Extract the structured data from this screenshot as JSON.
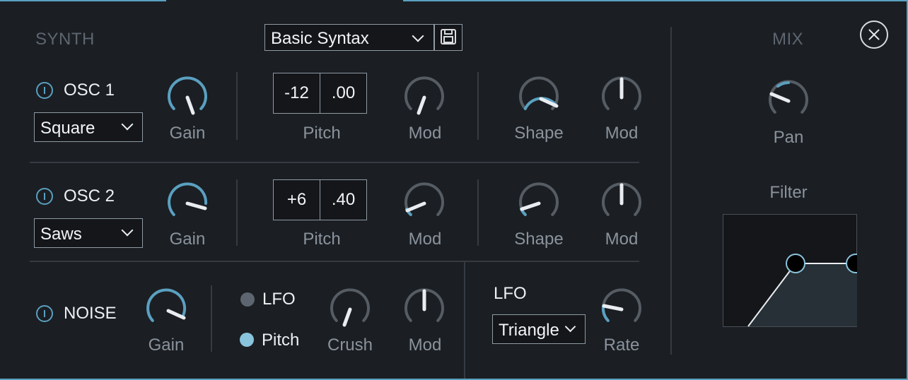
{
  "synth": {
    "section_title": "SYNTH",
    "preset": "Basic Syntax",
    "osc1": {
      "label": "OSC 1",
      "wave": "Square",
      "gain_label": "Gain",
      "pitch_coarse": "-12",
      "pitch_fine": ".00",
      "pitch_label": "Pitch",
      "mod1_label": "Mod",
      "shape_label": "Shape",
      "mod2_label": "Mod"
    },
    "osc2": {
      "label": "OSC 2",
      "wave": "Saws",
      "gain_label": "Gain",
      "pitch_coarse": "+6",
      "pitch_fine": ".40",
      "pitch_label": "Pitch",
      "mod1_label": "Mod",
      "shape_label": "Shape",
      "mod2_label": "Mod"
    },
    "noise": {
      "label": "NOISE",
      "gain_label": "Gain",
      "radio_lfo": "LFO",
      "radio_pitch": "Pitch",
      "crush_label": "Crush",
      "mod_label": "Mod"
    },
    "lfo": {
      "title": "LFO",
      "shape": "Triangle",
      "rate_label": "Rate"
    }
  },
  "mix": {
    "section_title": "MIX",
    "pan_label": "Pan",
    "filter_label": "Filter"
  },
  "colors": {
    "accent": "#5aa0c0",
    "background": "#1b1e23",
    "muted_text": "#8a939c"
  },
  "icons": {
    "save": "save-icon",
    "close": "close-icon",
    "power": "power-icon",
    "chevron": "chevron-down-icon"
  }
}
